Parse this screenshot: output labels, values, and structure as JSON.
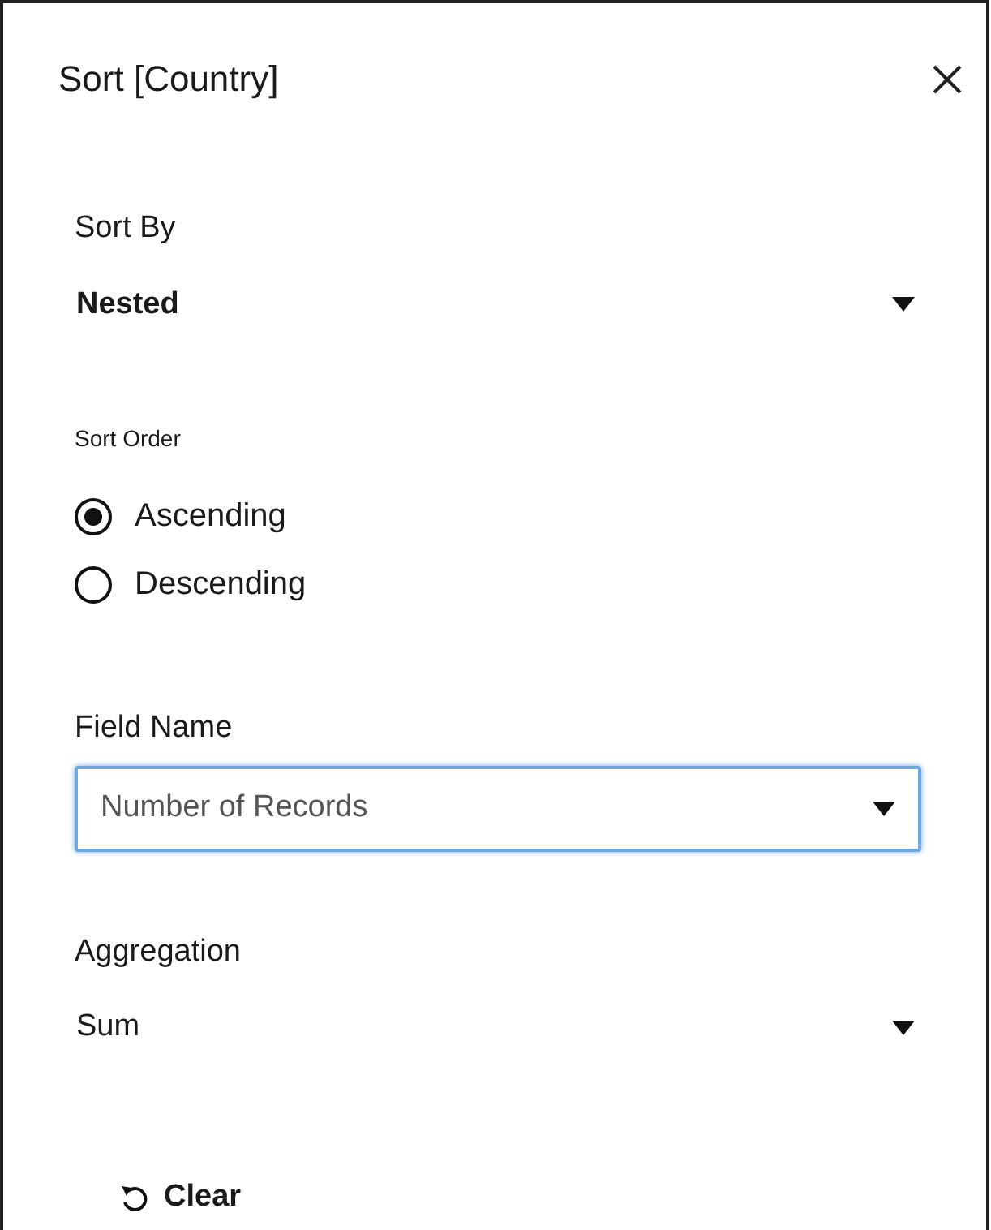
{
  "dialog": {
    "title": "Sort [Country]"
  },
  "sort_by": {
    "label": "Sort By",
    "value": "Nested"
  },
  "sort_order": {
    "label": "Sort Order",
    "options": [
      {
        "label": "Ascending",
        "selected": true
      },
      {
        "label": "Descending",
        "selected": false
      }
    ]
  },
  "field_name": {
    "label": "Field Name",
    "value": "Number of Records",
    "focused": true
  },
  "aggregation": {
    "label": "Aggregation",
    "value": "Sum"
  },
  "clear_button": {
    "label": "Clear"
  }
}
